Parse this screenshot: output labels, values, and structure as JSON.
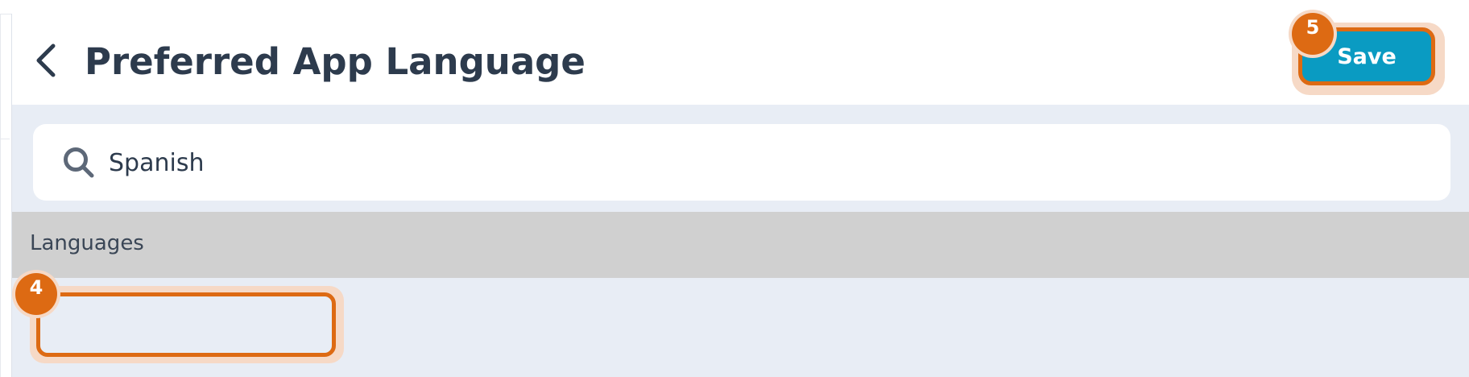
{
  "header": {
    "back_icon": "chevron-left-icon",
    "title": "Preferred App Language",
    "save_label": "Save"
  },
  "search": {
    "icon": "search-icon",
    "value": "Spanish"
  },
  "languages_section": {
    "label": "Languages",
    "items": []
  },
  "annotations": {
    "step_save": "5",
    "step_language_item": "4"
  },
  "colors": {
    "accent_orange": "#dd6a13",
    "save_blue": "#0a9bc2",
    "title_text": "#2d3b4d",
    "panel_bg": "#e8edf5",
    "section_bg": "#d0d0d0"
  }
}
